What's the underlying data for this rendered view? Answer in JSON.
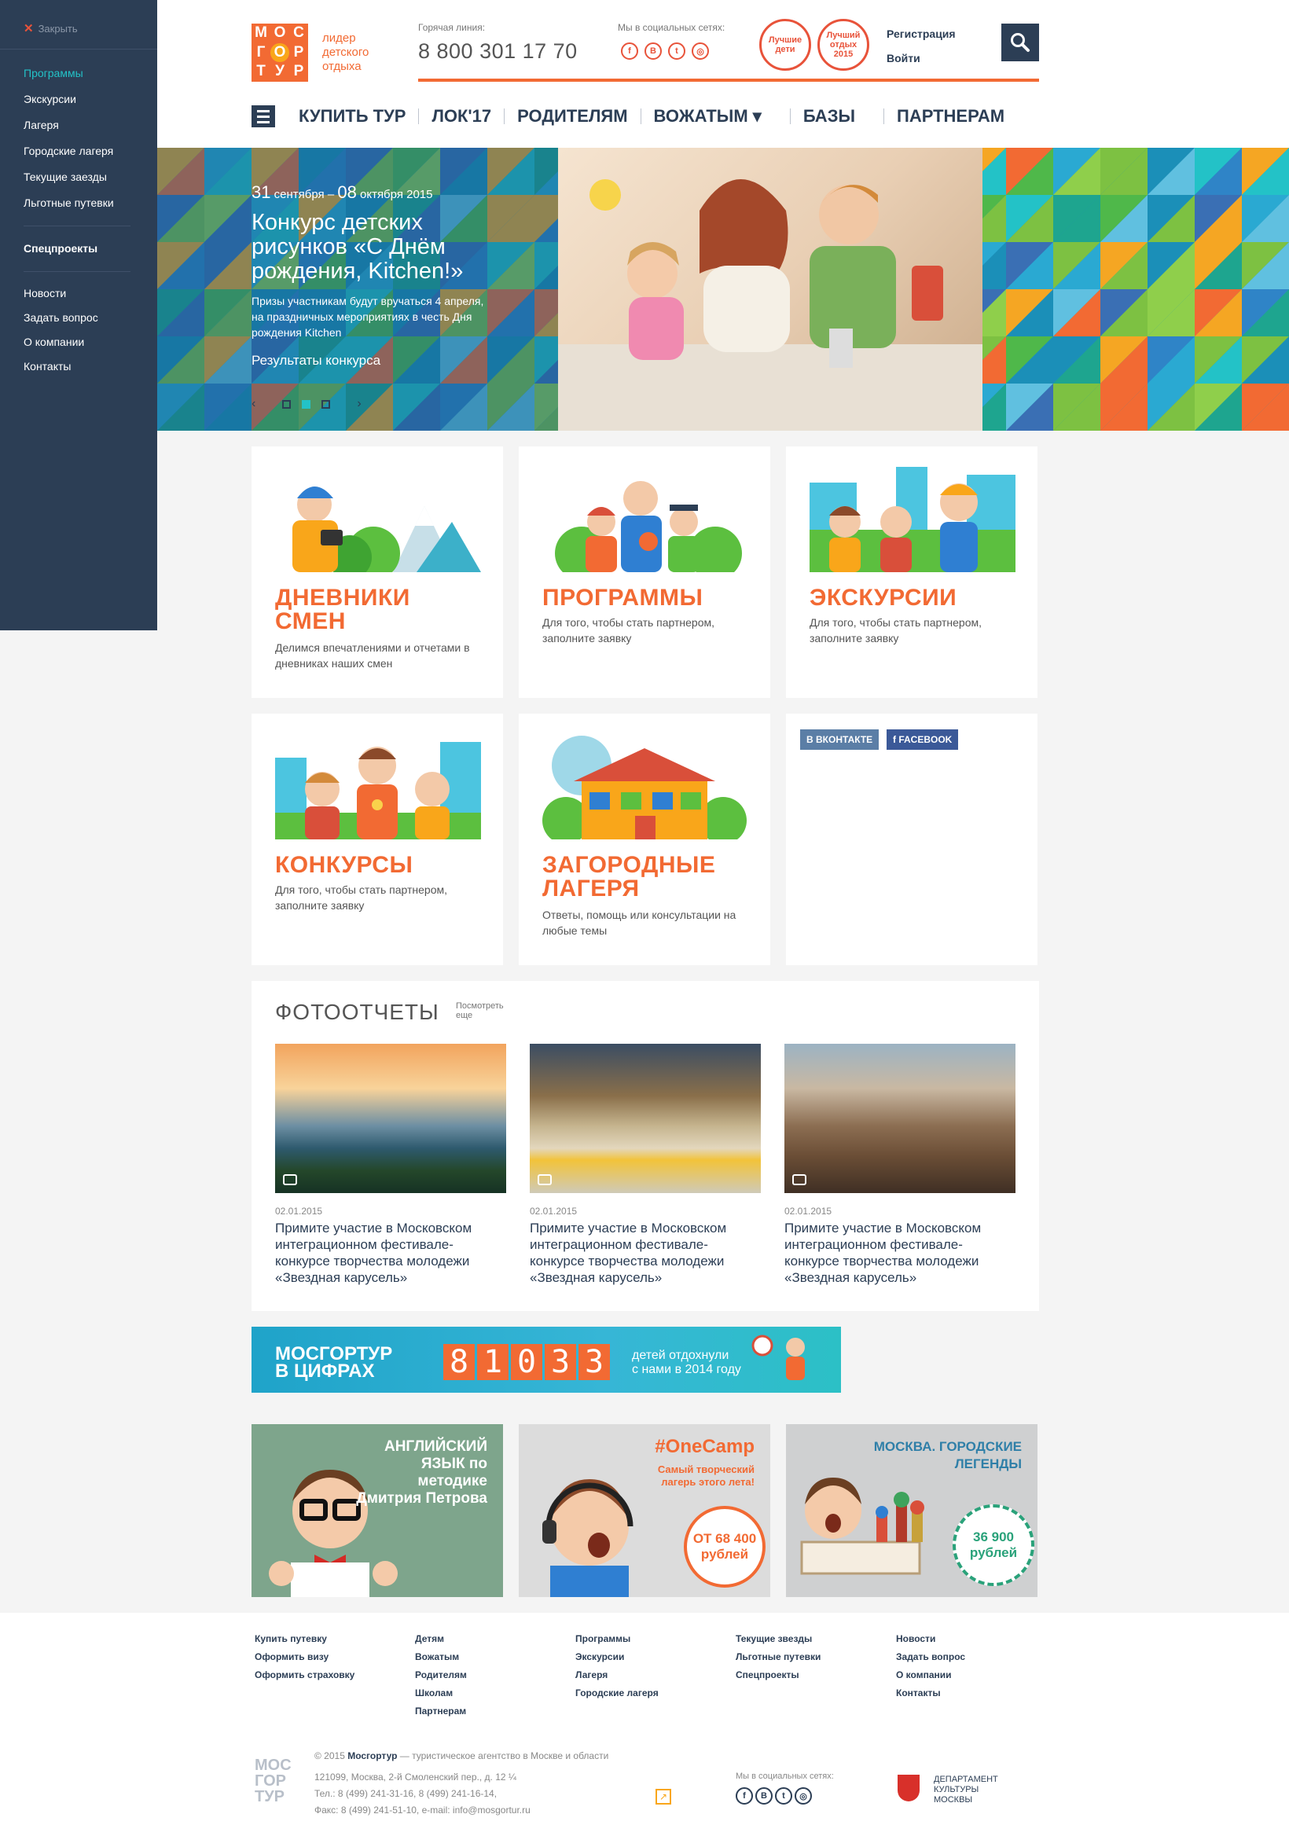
{
  "sidebar": {
    "close_label": "Закрыть",
    "items": [
      "Программы",
      "Экскурсии",
      "Лагеря",
      "Городские лагеря",
      "Текущие заезды",
      "Льготные путевки"
    ],
    "special": "Спецпроекты",
    "secondary": [
      "Новости",
      "Задать вопрос",
      "О компании",
      "Контакты"
    ]
  },
  "header": {
    "logo_letters": [
      "М",
      "О",
      "С",
      "Г",
      "О",
      "Р",
      "Т",
      "У",
      "Р"
    ],
    "tagline": [
      "лидер",
      "детского",
      "отдыха"
    ],
    "hotline_label": "Горячая линия:",
    "hotline": "8 800 301 17 70",
    "social_label": "Мы в социальных сетях:",
    "social": [
      "f",
      "В",
      "t",
      "◎"
    ],
    "awards": [
      "Лучшие дети",
      "Лучший отдых 2015"
    ],
    "register": "Регистрация",
    "login": "Войти",
    "nav": [
      "КУПИТЬ ТУР",
      "ЛОК'17",
      "РОДИТЕЛЯМ",
      "ВОЖАТЫМ ▾",
      "БАЗЫ",
      "ПАРТНЕРАМ"
    ]
  },
  "hero": {
    "date_day1": "31",
    "date_month1": " сентября – ",
    "date_day2": "08",
    "date_month2": " октября 2015",
    "title": "Конкурс детских рисунков «С Днём рождения, Kitchen!»",
    "desc": "Призы участникам будут вручаться 4 апреля, на праздничных мероприятиях в честь Дня рождения Kitchen",
    "link": "Результаты конкурса",
    "prev": "‹",
    "next": "›"
  },
  "cards": [
    {
      "title": "ДНЕВНИКИ СМЕН",
      "desc": "Делимся впечатлениями и отчетами в дневниках наших смен"
    },
    {
      "title": "ПРОГРАММЫ",
      "desc": "Для того, чтобы стать партнером, заполните заявку"
    },
    {
      "title": "ЭКСКУРСИИ",
      "desc": "Для того, чтобы стать партнером, заполните заявку"
    },
    {
      "title": "КОНКУРСЫ",
      "desc": "Для того, чтобы стать партнером, заполните заявку"
    },
    {
      "title": "ЗАГОРОДНЫЕ ЛАГЕРЯ",
      "desc": "Ответы, помощь или консультации на любые темы"
    }
  ],
  "social_card": {
    "vk": "В ВКОНТАКТЕ",
    "fb": "f FACEBOOK"
  },
  "photos": {
    "title": "ФОТООТЧЕТЫ",
    "more": "Посмотреть еще",
    "items": [
      {
        "date": "02.01.2015",
        "text": "Примите участие в Московском интеграционном фестивале-конкурсе творчества молодежи «Звездная карусель»"
      },
      {
        "date": "02.01.2015",
        "text": "Примите участие в Московском интеграционном фестивале-конкурсе творчества молодежи «Звездная карусель»"
      },
      {
        "date": "02.01.2015",
        "text": "Примите участие в Московском интеграционном фестивале-конкурсе творчества молодежи «Звездная карусель»"
      }
    ]
  },
  "banner": {
    "title_line1": "МОСГОРТУР",
    "title_line2": "В ЦИФРАХ",
    "digits": [
      "8",
      "1",
      "0",
      "3",
      "3"
    ],
    "sub_line1": "детей отдохнули",
    "sub_line2": "с нами в 2014 году"
  },
  "promos": [
    {
      "title": "АНГЛИЙСКИЙ ЯЗЫК по методике Дмитрия Петрова"
    },
    {
      "title": "#OneCamp",
      "sub": "Самый творческий лагерь этого лета!",
      "badge": "ОТ 68 400 рублей"
    },
    {
      "title": "МОСКВА. ГОРОДСКИЕ ЛЕГЕНДЫ",
      "badge": "36 900 рублей"
    }
  ],
  "footer": {
    "cols": [
      [
        "Купить путевку",
        "Оформить визу",
        "Оформить страховку"
      ],
      [
        "Детям",
        "Вожатым",
        "Родителям",
        "Школам",
        "Партнерам"
      ],
      [
        "Программы",
        "Экскурсии",
        "Лагеря",
        "Городские лагеря"
      ],
      [
        "Текущие звезды",
        "Льготные путевки",
        "Спецпроекты"
      ],
      [
        "Новости",
        "Задать вопрос",
        "О компании",
        "Контакты"
      ]
    ],
    "logo": "МОС ГОР ТУР",
    "copyright_pre": "© 2015 ",
    "brand": "Мосгортур",
    "copyright_post": " — туристическое агентство в Москве и области",
    "address": "121099, Москва, 2-й Смоленский пер., д. 12 ¼",
    "phones": "Тел.: 8 (499) 241-31-16, 8 (499) 241-16-14,",
    "fax": "Факс: 8 (499) 241-51-10, e-mail: info@mosgortur.ru",
    "social_label": "Мы в социальных сетях:",
    "dept": [
      "ДЕПАРТАМЕНТ",
      "КУЛЬТУРЫ",
      "МОСКВЫ"
    ]
  },
  "colors": {
    "accent": "#f26a33",
    "navy": "#2c3e55",
    "teal": "#23c2c7"
  }
}
